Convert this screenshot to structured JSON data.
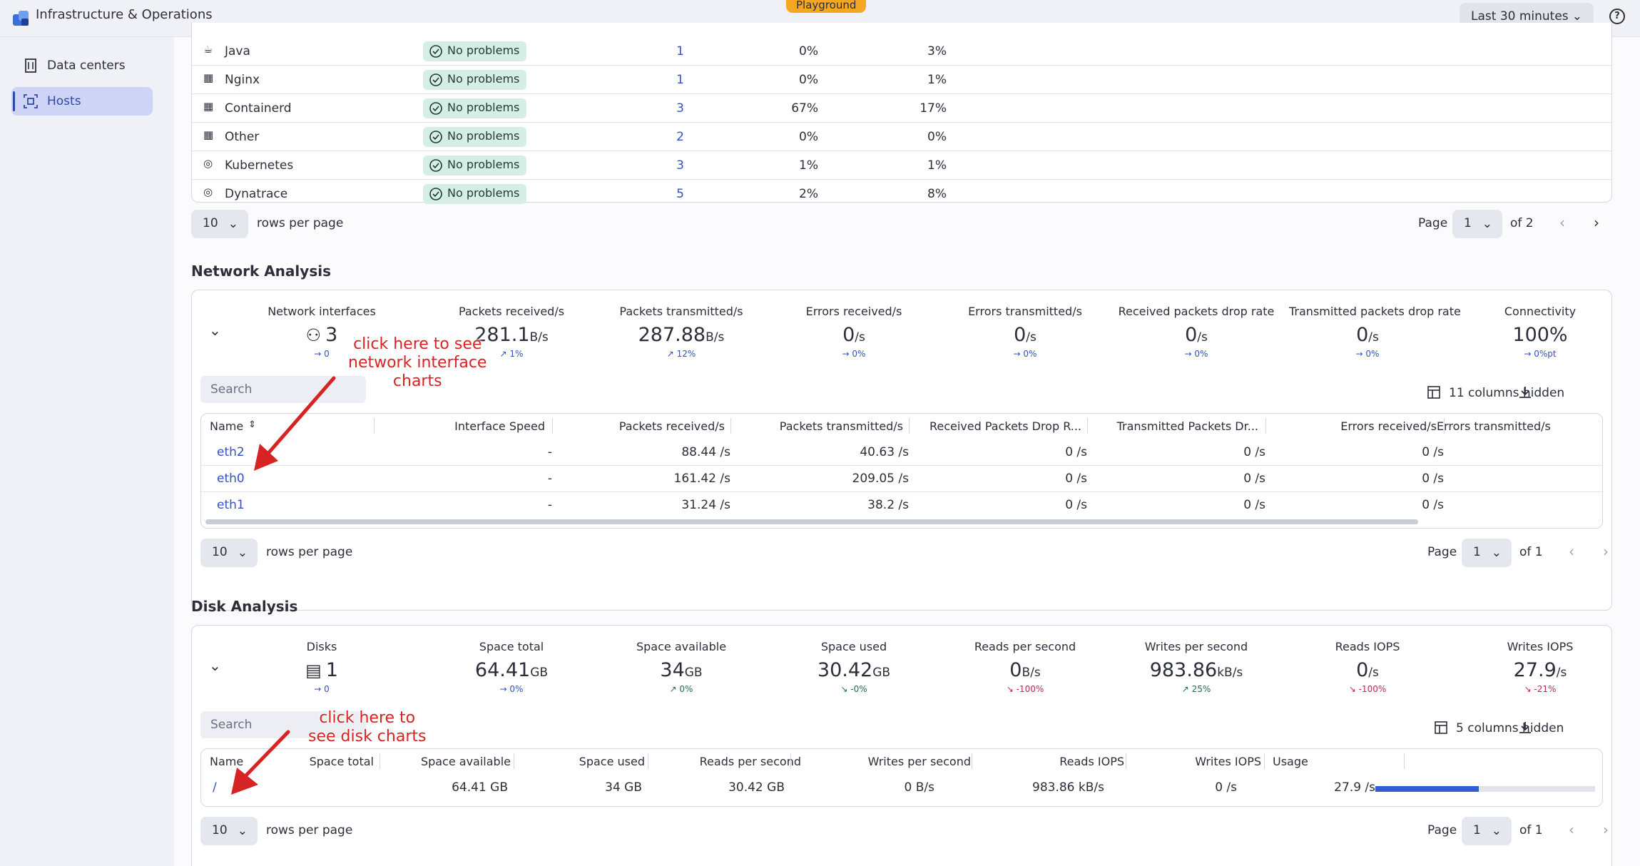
{
  "app": {
    "title": "Infrastructure & Operations",
    "badge": "Playground",
    "timeframe": "Last 30 minutes",
    "help": "?"
  },
  "sidebar": {
    "items": [
      {
        "label": "Data centers"
      },
      {
        "label": "Hosts"
      }
    ]
  },
  "process_table": {
    "rows": [
      {
        "name": "Java",
        "status": "No problems",
        "count": "1",
        "cpu": "0%",
        "mem": "3%"
      },
      {
        "name": "Nginx",
        "status": "No problems",
        "count": "1",
        "cpu": "0%",
        "mem": "1%"
      },
      {
        "name": "Containerd",
        "status": "No problems",
        "count": "3",
        "cpu": "67%",
        "mem": "17%"
      },
      {
        "name": "Other",
        "status": "No problems",
        "count": "2",
        "cpu": "0%",
        "mem": "0%"
      },
      {
        "name": "Kubernetes",
        "status": "No problems",
        "count": "3",
        "cpu": "1%",
        "mem": "1%"
      },
      {
        "name": "Dynatrace",
        "status": "No problems",
        "count": "5",
        "cpu": "2%",
        "mem": "8%"
      }
    ],
    "rows_per_page": "10",
    "rows_per_page_label": "rows per page",
    "page_label": "Page",
    "page": "1",
    "of_pages": "of 2"
  },
  "network": {
    "title": "Network Analysis",
    "metrics": [
      {
        "label": "Network interfaces",
        "value": "3",
        "unit": "",
        "delta": "→ 0"
      },
      {
        "label": "Packets received/s",
        "value": "281.1",
        "unit": "B/s",
        "delta": "↗ 1%"
      },
      {
        "label": "Packets transmitted/s",
        "value": "287.88",
        "unit": "B/s",
        "delta": "↗ 12%"
      },
      {
        "label": "Errors received/s",
        "value": "0",
        "unit": "/s",
        "delta": "→ 0%"
      },
      {
        "label": "Errors transmitted/s",
        "value": "0",
        "unit": "/s",
        "delta": "→ 0%"
      },
      {
        "label": "Received packets drop rate",
        "value": "0",
        "unit": "/s",
        "delta": "→ 0%"
      },
      {
        "label": "Transmitted packets drop rate",
        "value": "0",
        "unit": "/s",
        "delta": "→ 0%"
      },
      {
        "label": "Connectivity",
        "value": "100%",
        "unit": "",
        "delta": "→ 0%pt"
      }
    ],
    "search_placeholder": "Search",
    "columns_hidden": "11 columns hidden",
    "headers": [
      "Name",
      "Interface Speed",
      "Packets received/s",
      "Packets transmitted/s",
      "Received Packets Drop R...",
      "Transmitted Packets Dr...",
      "Errors received/s",
      "Errors transmitted/s"
    ],
    "rows": [
      {
        "name": "eth2",
        "speed": "-",
        "rx": "88.44 /s",
        "tx": "40.63 /s",
        "rxdrop": "0 /s",
        "txdrop": "0 /s",
        "err": "0 /s"
      },
      {
        "name": "eth0",
        "speed": "-",
        "rx": "161.42 /s",
        "tx": "209.05 /s",
        "rxdrop": "0 /s",
        "txdrop": "0 /s",
        "err": "0 /s"
      },
      {
        "name": "eth1",
        "speed": "-",
        "rx": "31.24 /s",
        "tx": "38.2 /s",
        "rxdrop": "0 /s",
        "txdrop": "0 /s",
        "err": "0 /s"
      }
    ],
    "rows_per_page": "10",
    "page": "1",
    "of_pages": "of 1",
    "annotation": [
      "click here to see",
      "network interface",
      "charts"
    ]
  },
  "disk": {
    "title": "Disk Analysis",
    "metrics": [
      {
        "label": "Disks",
        "value": "1",
        "unit": "",
        "delta": "→ 0",
        "tone": ""
      },
      {
        "label": "Space total",
        "value": "64.41",
        "unit": "GB",
        "delta": "→ 0%",
        "tone": ""
      },
      {
        "label": "Space available",
        "value": "34",
        "unit": "GB",
        "delta": "↗ 0%",
        "tone": "pos"
      },
      {
        "label": "Space used",
        "value": "30.42",
        "unit": "GB",
        "delta": "↘ -0%",
        "tone": "pos"
      },
      {
        "label": "Reads per second",
        "value": "0",
        "unit": "B/s",
        "delta": "↘ -100%",
        "tone": "neg"
      },
      {
        "label": "Writes per second",
        "value": "983.86",
        "unit": "kB/s",
        "delta": "↗ 25%",
        "tone": "pos"
      },
      {
        "label": "Reads IOPS",
        "value": "0",
        "unit": "/s",
        "delta": "↘ -100%",
        "tone": "neg"
      },
      {
        "label": "Writes IOPS",
        "value": "27.9",
        "unit": "/s",
        "delta": "↘ -21%",
        "tone": "neg"
      }
    ],
    "search_placeholder": "Search",
    "columns_hidden": "5 columns hidden",
    "headers": [
      "Name",
      "Space total",
      "Space available",
      "Space used",
      "Reads per second",
      "Writes per second",
      "Reads IOPS",
      "Writes IOPS",
      "Usage"
    ],
    "rows": [
      {
        "name": "/",
        "total": "64.41 GB",
        "avail": "34 GB",
        "used": "30.42 GB",
        "reads": "0 B/s",
        "writes": "983.86 kB/s",
        "riops": "0 /s",
        "wiops": "27.9 /s",
        "usage_fraction": 0.47
      }
    ],
    "rows_per_page": "10",
    "page": "1",
    "of_pages": "of 1",
    "annotation": [
      "click here to",
      "see disk charts"
    ]
  },
  "colors": {
    "accent": "#3350c8",
    "badge_bg": "#d6efe6",
    "playground": "#f5a623",
    "annotation": "#d62424",
    "usage_bar": "#2f5fd0"
  }
}
